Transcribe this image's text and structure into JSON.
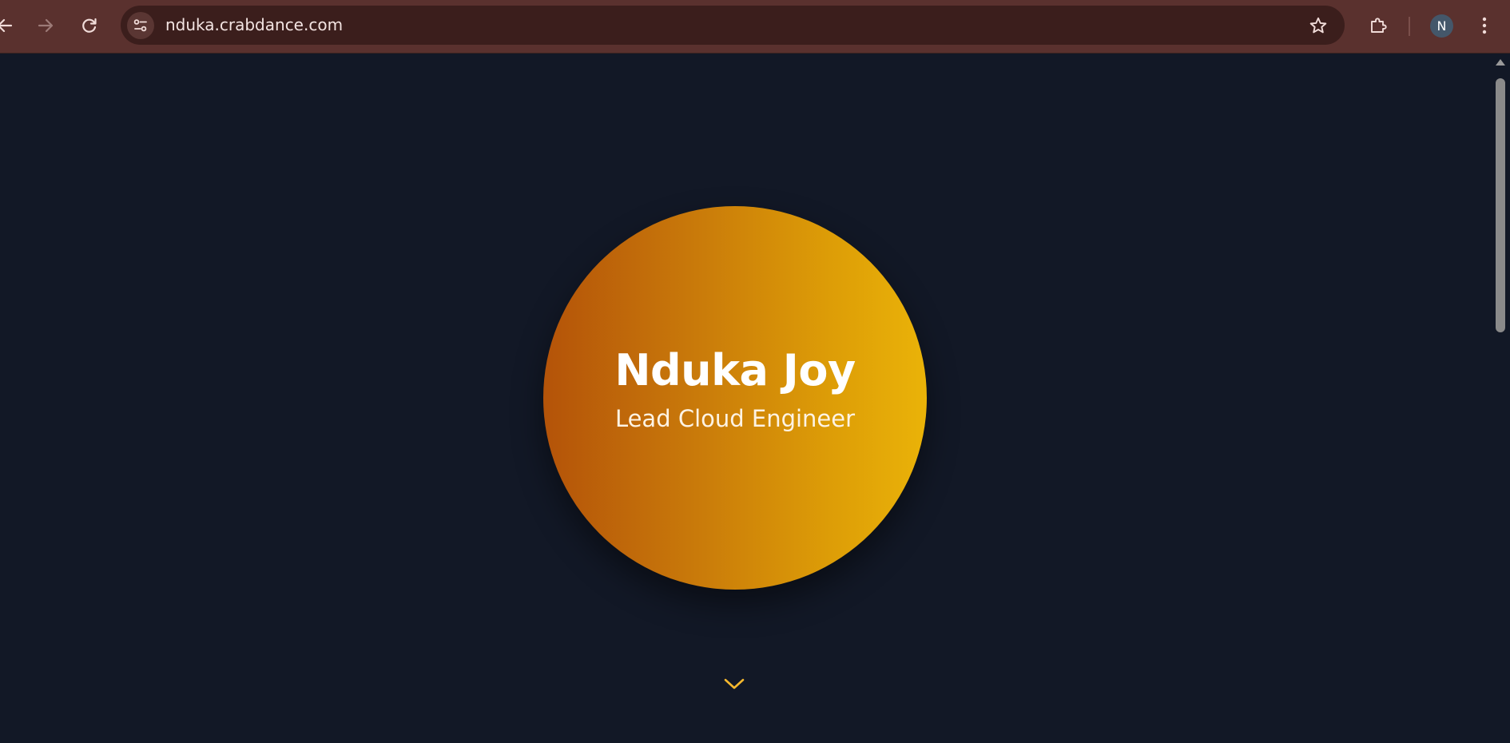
{
  "browser": {
    "url": "nduka.crabdance.com",
    "profile_initial": "N",
    "icons": {
      "back": "back-arrow-icon",
      "forward": "forward-arrow-icon",
      "reload": "reload-icon",
      "site_info": "tune-icon",
      "bookmark": "star-icon",
      "extensions": "puzzle-icon",
      "menu": "kebab-menu-icon"
    },
    "colors": {
      "toolbar": "#5a312e",
      "omnibox": "#3b1e1c"
    }
  },
  "hero": {
    "name": "Nduka Joy",
    "title": "Lead Cloud Engineer",
    "gradient_start": "#b45309",
    "gradient_end": "#eab308",
    "scroll_icon": "chevron-down-icon",
    "scroll_icon_color": "#f5b82e"
  },
  "page": {
    "background": "#121826"
  }
}
